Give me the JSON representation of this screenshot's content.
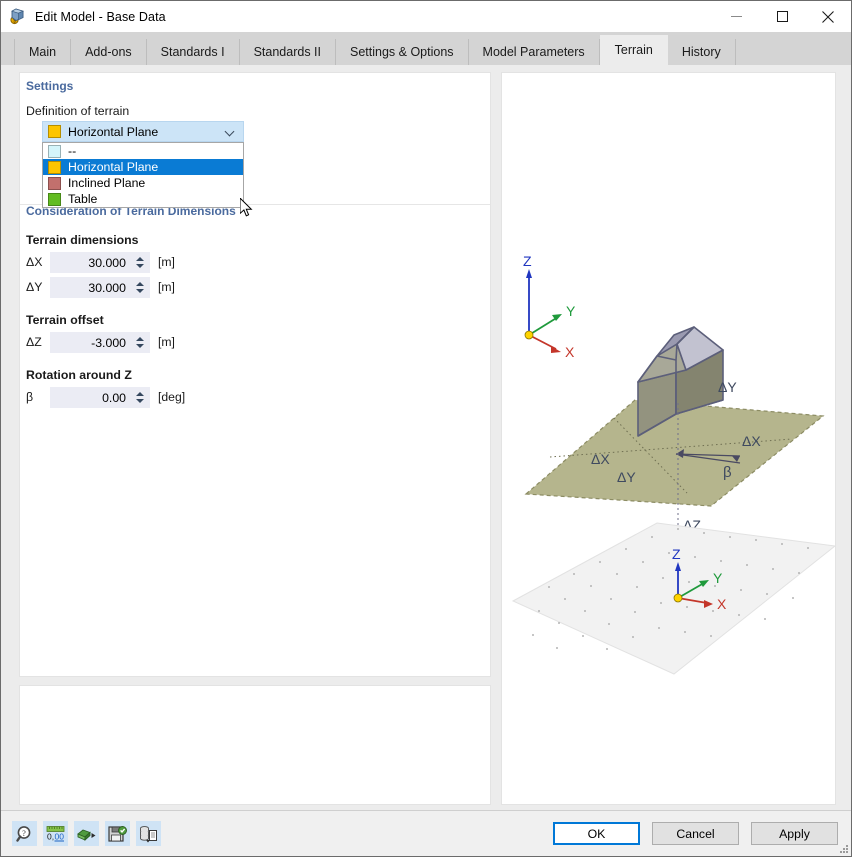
{
  "window": {
    "title": "Edit Model - Base Data",
    "icon": "app-cube-icon",
    "minimize": "minimize-icon",
    "maximize": "maximize-icon",
    "close": "close-icon"
  },
  "tabs": [
    {
      "label": "Main",
      "active": false
    },
    {
      "label": "Add-ons",
      "active": false
    },
    {
      "label": "Standards I",
      "active": false
    },
    {
      "label": "Standards II",
      "active": false
    },
    {
      "label": "Settings & Options",
      "active": false
    },
    {
      "label": "Model Parameters",
      "active": false
    },
    {
      "label": "Terrain",
      "active": true
    },
    {
      "label": "History",
      "active": false
    }
  ],
  "settings": {
    "group_title": "Settings",
    "definition_label": "Definition of terrain",
    "combo": {
      "value": "Horizontal Plane",
      "swatch_color": "#fdc500",
      "open": true,
      "options": [
        {
          "label": "--",
          "swatch_color": "#d4f5fb",
          "selected": false
        },
        {
          "label": "Horizontal Plane",
          "swatch_color": "#fdc500",
          "selected": true
        },
        {
          "label": "Inclined Plane",
          "swatch_color": "#c2706d",
          "selected": false
        },
        {
          "label": "Table",
          "swatch_color": "#62bc21",
          "selected": false
        }
      ]
    }
  },
  "consideration": {
    "group_title": "Consideration of Terrain Dimensions",
    "dimensions_label": "Terrain dimensions",
    "offset_label": "Terrain offset",
    "rotation_label": "Rotation around Z",
    "fields": [
      {
        "name": "delta-x",
        "symbol": "ΔX",
        "value": "30.000",
        "unit": "[m]"
      },
      {
        "name": "delta-y",
        "symbol": "ΔY",
        "value": "30.000",
        "unit": "[m]"
      },
      {
        "name": "delta-z",
        "symbol": "ΔZ",
        "value": "-3.000",
        "unit": "[m]"
      },
      {
        "name": "beta",
        "symbol": "β",
        "value": "0.00",
        "unit": "[deg]"
      }
    ]
  },
  "viewport": {
    "name": "terrain-3d-preview",
    "upper_axes": {
      "z": "Z",
      "y": "Y",
      "x": "X"
    },
    "lower_axes": {
      "z": "Z",
      "y": "Y",
      "x": "X"
    },
    "annotations": {
      "dx_left": "ΔX",
      "dy_left": "ΔY",
      "dy_right": "ΔY",
      "dx_right": "ΔX",
      "beta": "β",
      "dz": "ΔZ"
    },
    "colors": {
      "terrain_plane": "#b5b58d",
      "grid_plane": "#f0f0f0",
      "axis_x": "#c4362a",
      "axis_y": "#1f9a3c",
      "axis_z": "#2036c0",
      "origin": "#ffd400",
      "building": "#8a8a8a"
    }
  },
  "toolbar": {
    "buttons": [
      {
        "name": "help-lookup-button",
        "icon": "magnifier-question-icon"
      },
      {
        "name": "decimal-places-button",
        "icon": "number-format-icon"
      },
      {
        "name": "import-button",
        "icon": "import-arrow-icon"
      },
      {
        "name": "save-as-button",
        "icon": "save-plus-icon"
      },
      {
        "name": "export-data-button",
        "icon": "database-export-icon"
      }
    ]
  },
  "dialog_buttons": {
    "ok": "OK",
    "cancel": "Cancel",
    "apply": "Apply"
  }
}
